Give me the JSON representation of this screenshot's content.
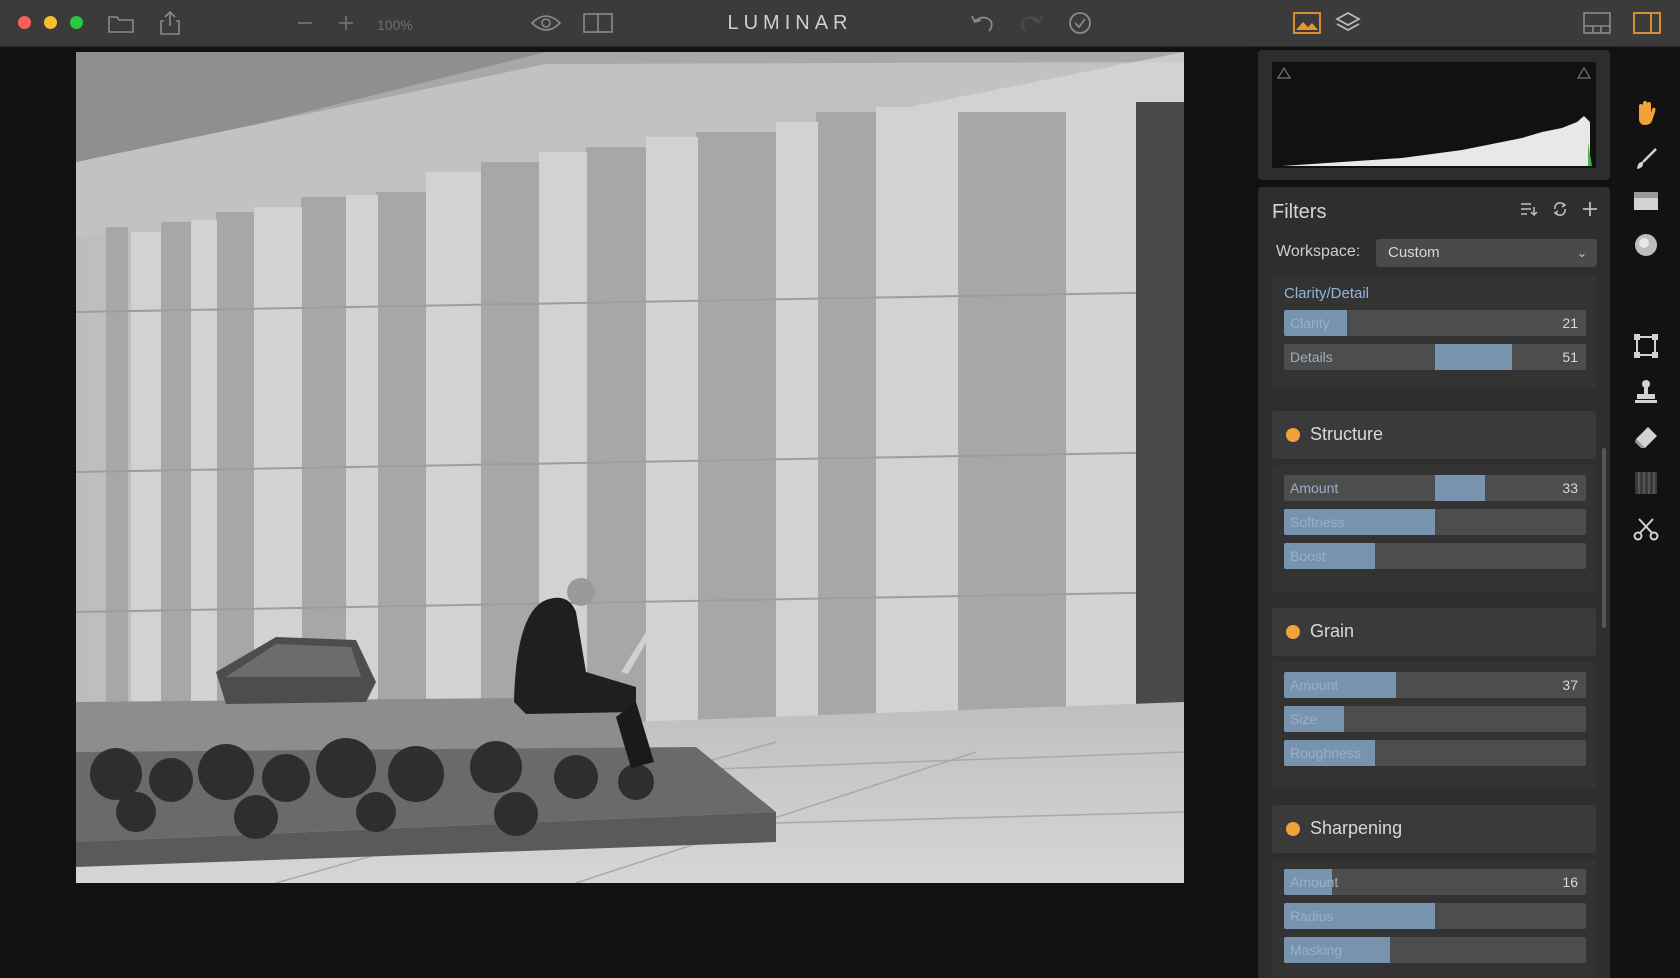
{
  "app": {
    "title": "LUMINAR"
  },
  "toolbar": {
    "zoom": "100%"
  },
  "colors": {
    "accent": "#f2a23a",
    "slider_fill": "#7793ad",
    "group_label": "#8fb7db"
  },
  "filters": {
    "title": "Filters",
    "workspace_label": "Workspace:",
    "workspace_value": "Custom",
    "clarity_group": {
      "label": "Clarity/Detail",
      "sliders": [
        {
          "label": "Clarity",
          "value": "21",
          "fill": 0.21,
          "centered": false
        },
        {
          "label": "Details",
          "value": "51",
          "fill": 0.51,
          "centered": true
        }
      ]
    },
    "sections": [
      {
        "title": "Structure",
        "sliders": [
          {
            "label": "Amount",
            "value": "33",
            "fill": 0.33,
            "centered": true
          },
          {
            "label": "Softness",
            "value": "",
            "fill": 0.5,
            "centered": false
          },
          {
            "label": "Boost",
            "value": "",
            "fill": 0.3,
            "centered": false
          }
        ]
      },
      {
        "title": "Grain",
        "sliders": [
          {
            "label": "Amount",
            "value": "37",
            "fill": 0.37,
            "centered": false
          },
          {
            "label": "Size",
            "value": "",
            "fill": 0.2,
            "centered": false
          },
          {
            "label": "Roughness",
            "value": "",
            "fill": 0.3,
            "centered": false
          }
        ]
      },
      {
        "title": "Sharpening",
        "sliders": [
          {
            "label": "Amount",
            "value": "16",
            "fill": 0.16,
            "centered": false
          },
          {
            "label": "Radius",
            "value": "",
            "fill": 0.5,
            "centered": false
          },
          {
            "label": "Masking",
            "value": "",
            "fill": 0.35,
            "centered": false
          }
        ]
      }
    ]
  },
  "icons": {
    "titlebar": [
      "folder-icon",
      "share-icon",
      "zoom-out-icon",
      "zoom-in-icon",
      "eye-icon",
      "compare-icon",
      "undo-icon",
      "redo-icon",
      "history-icon",
      "image-icon",
      "layers-icon",
      "layout-icon",
      "sidebar-icon"
    ],
    "tools": [
      "hand-icon",
      "brush-icon",
      "gradient-icon",
      "radial-icon",
      "crop-icon",
      "clone-stamp-icon",
      "eraser-icon",
      "pattern-icon",
      "cut-icon"
    ]
  }
}
